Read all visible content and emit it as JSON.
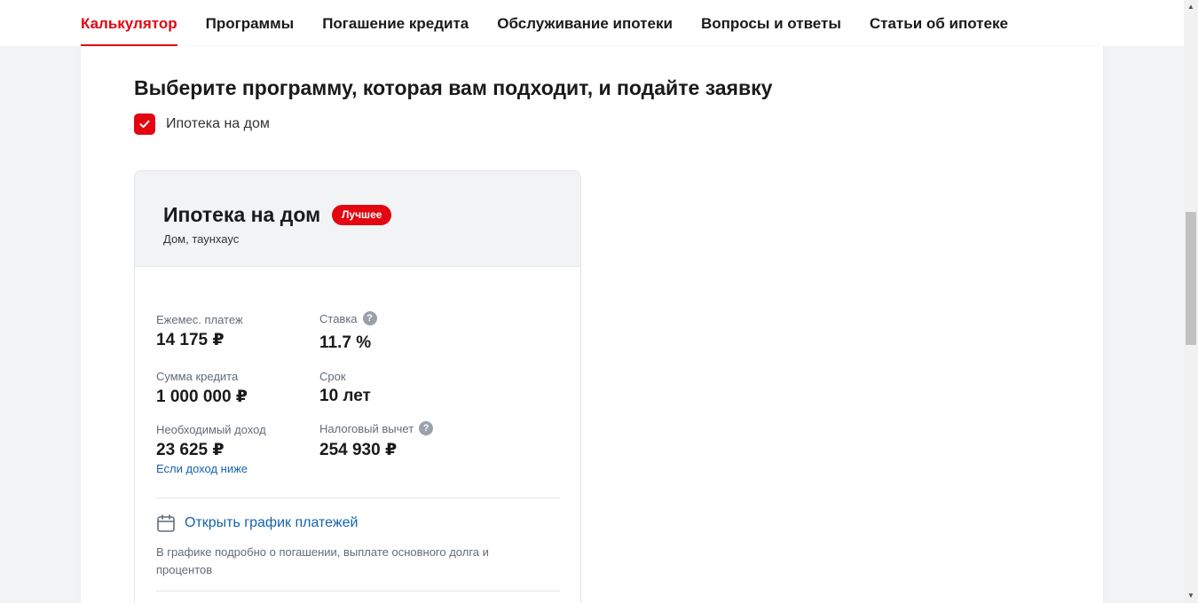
{
  "nav": {
    "tabs": [
      {
        "label": "Калькулятор",
        "active": true
      },
      {
        "label": "Программы"
      },
      {
        "label": "Погашение кредита"
      },
      {
        "label": "Обслуживание ипотеки"
      },
      {
        "label": "Вопросы и ответы"
      },
      {
        "label": "Статьи об ипотеке"
      }
    ]
  },
  "main": {
    "heading": "Выберите программу, которая вам подходит, и подайте заявку",
    "filter": {
      "label": "Ипотека на дом",
      "checked": true
    }
  },
  "card": {
    "title": "Ипотека на дом",
    "badge": "Лучшее",
    "subtitle": "Дом, таунхаус",
    "metrics": {
      "monthly_payment": {
        "label": "Ежемес. платеж",
        "value": "14 175 ₽"
      },
      "rate": {
        "label": "Ставка",
        "value": "11.7 %"
      },
      "loan_amount": {
        "label": "Сумма кредита",
        "value": "1 000 000 ₽"
      },
      "term": {
        "label": "Срок",
        "value": "10 лет"
      },
      "required_income": {
        "label": "Необходимый доход",
        "value": "23 625 ₽",
        "link": "Если доход ниже"
      },
      "tax_deduction": {
        "label": "Налоговый вычет",
        "value": "254 930 ₽"
      }
    },
    "schedule": {
      "link": "Открыть график платежей",
      "description": "В графике подробно о погашении, выплате основного долга и процентов"
    }
  },
  "colors": {
    "accent": "#e30611",
    "link": "#1463ad",
    "muted": "#626c77"
  },
  "icons": {
    "help": "?",
    "check": "check-icon",
    "calendar": "calendar-icon"
  }
}
